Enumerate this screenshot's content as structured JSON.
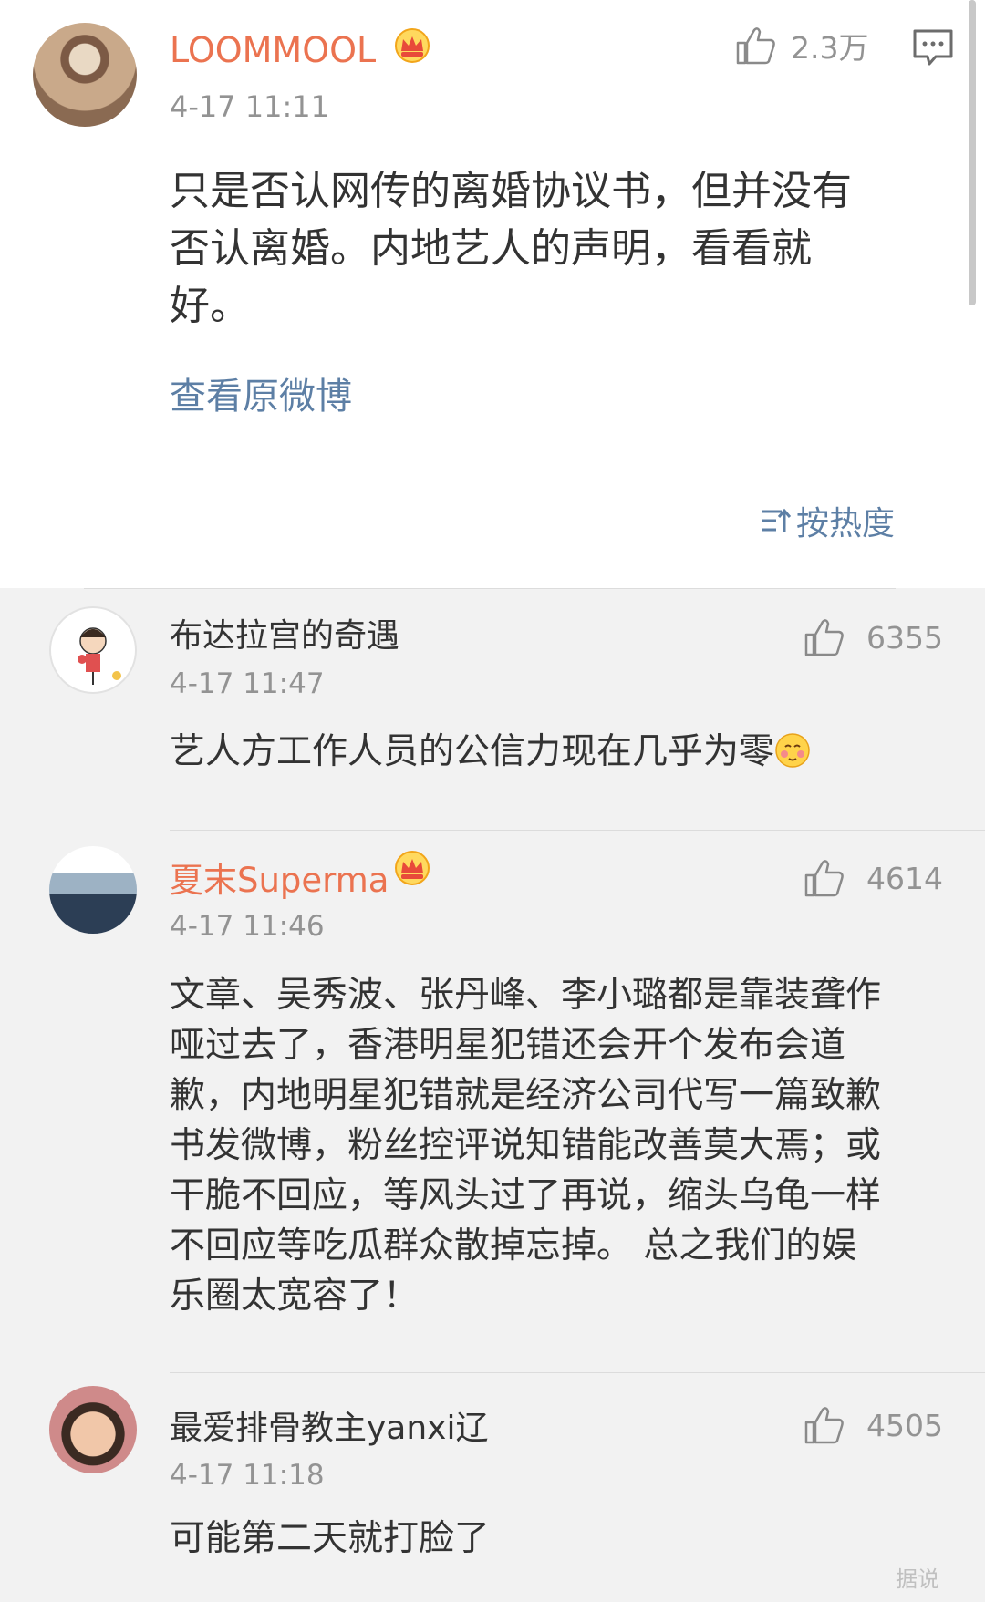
{
  "main_post": {
    "username": "LOOMMOOL",
    "time": "4-17 11:11",
    "likes": "2.3万",
    "text_lines": [
      "只是否认网传的离婚协议书，但并没有",
      "否认离婚。内地艺人的声明，看看就",
      "好。"
    ],
    "view_original": "查看原微博",
    "sort_label": "按热度"
  },
  "comments": [
    {
      "username": "布达拉宫的奇遇",
      "time": "4-17 11:47",
      "likes": "6355",
      "text": "艺人方工作人员的公信力现在几乎为零"
    },
    {
      "username": "夏末Superma",
      "time": "4-17 11:46",
      "likes": "4614",
      "text_lines": [
        "文章、吴秀波、张丹峰、李小璐都是靠装聋作",
        "哑过去了，香港明星犯错还会开个发布会道",
        "歉，内地明星犯错就是经济公司代写一篇致歉",
        "书发微博，粉丝控评说知错能改善莫大焉；或",
        "干脆不回应，等风头过了再说，缩头乌龟一样",
        "不回应等吃瓜群众散掉忘掉。 总之我们的娱",
        "乐圈太宽容了！"
      ]
    },
    {
      "username": "最爱排骨教主yanxi辽",
      "time": "4-17 11:18",
      "likes": "4505",
      "text": "可能第二天就打脸了"
    }
  ],
  "watermark": "据说"
}
